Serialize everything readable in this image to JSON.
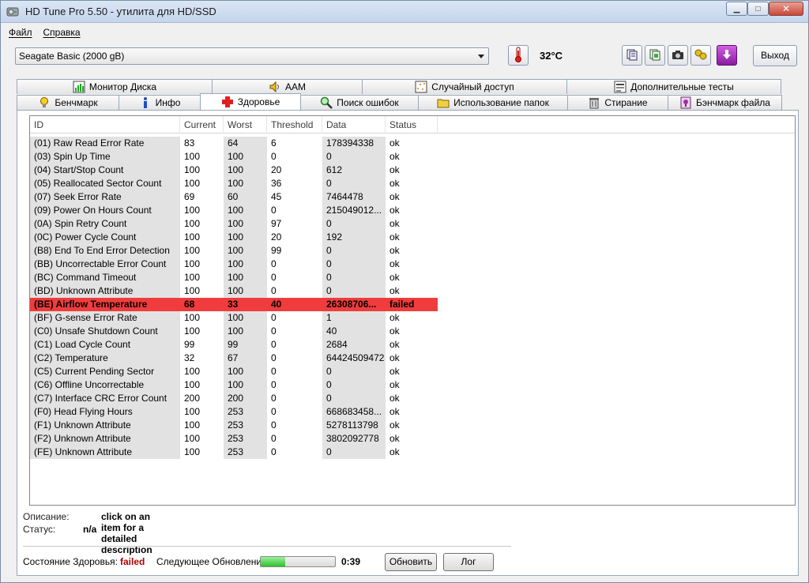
{
  "window": {
    "title": "HD Tune Pro 5.50 - утилита для HD/SSD"
  },
  "menu": {
    "file": "Файл",
    "help": "Справка"
  },
  "toolbar": {
    "drive": "Seagate Basic (2000 gB)",
    "temperature": "32°C",
    "exit_label": "Выход"
  },
  "tabs_top": [
    {
      "label": "Монитор Диска",
      "icon": "monitor-chart-icon"
    },
    {
      "label": "AAM",
      "icon": "speaker-icon"
    },
    {
      "label": "Случайный доступ",
      "icon": "random-access-icon"
    },
    {
      "label": "Дополнительные  тесты",
      "icon": "extra-tests-icon"
    }
  ],
  "tabs_bottom": [
    {
      "label": "Бенчмарк",
      "icon": "lightbulb-icon"
    },
    {
      "label": "Инфо",
      "icon": "info-icon"
    },
    {
      "label": "Здоровье",
      "icon": "health-cross-icon"
    },
    {
      "label": "Поиск ошибок",
      "icon": "magnifier-icon"
    },
    {
      "label": "Использование папок",
      "icon": "folder-icon"
    },
    {
      "label": "Стирание",
      "icon": "trash-icon"
    },
    {
      "label": "Бэнчмарк файла",
      "icon": "file-benchmark-icon"
    }
  ],
  "table": {
    "columns": [
      "ID",
      "Current",
      "Worst",
      "Threshold",
      "Data",
      "Status"
    ],
    "rows": [
      [
        "(01) Raw Read Error Rate",
        "83",
        "64",
        "6",
        "178394338",
        "ok"
      ],
      [
        "(03) Spin Up Time",
        "100",
        "100",
        "0",
        "0",
        "ok"
      ],
      [
        "(04) Start/Stop Count",
        "100",
        "100",
        "20",
        "612",
        "ok"
      ],
      [
        "(05) Reallocated Sector Count",
        "100",
        "100",
        "36",
        "0",
        "ok"
      ],
      [
        "(07) Seek Error Rate",
        "69",
        "60",
        "45",
        "7464478",
        "ok"
      ],
      [
        "(09) Power On Hours Count",
        "100",
        "100",
        "0",
        "215049012...",
        "ok"
      ],
      [
        "(0A) Spin Retry Count",
        "100",
        "100",
        "97",
        "0",
        "ok"
      ],
      [
        "(0C) Power Cycle Count",
        "100",
        "100",
        "20",
        "192",
        "ok"
      ],
      [
        "(B8) End To End Error Detection",
        "100",
        "100",
        "99",
        "0",
        "ok"
      ],
      [
        "(BB) Uncorrectable Error Count",
        "100",
        "100",
        "0",
        "0",
        "ok"
      ],
      [
        "(BC) Command Timeout",
        "100",
        "100",
        "0",
        "0",
        "ok"
      ],
      [
        "(BD) Unknown Attribute",
        "100",
        "100",
        "0",
        "0",
        "ok"
      ],
      [
        "(BE) Airflow Temperature",
        "68",
        "33",
        "40",
        "26308706...",
        "failed"
      ],
      [
        "(BF) G-sense Error Rate",
        "100",
        "100",
        "0",
        "1",
        "ok"
      ],
      [
        "(C0) Unsafe Shutdown Count",
        "100",
        "100",
        "0",
        "40",
        "ok"
      ],
      [
        "(C1) Load Cycle Count",
        "99",
        "99",
        "0",
        "2684",
        "ok"
      ],
      [
        "(C2) Temperature",
        "32",
        "67",
        "0",
        "64424509472",
        "ok"
      ],
      [
        "(C5) Current Pending Sector",
        "100",
        "100",
        "0",
        "0",
        "ok"
      ],
      [
        "(C6) Offline Uncorrectable",
        "100",
        "100",
        "0",
        "0",
        "ok"
      ],
      [
        "(C7) Interface CRC Error Count",
        "200",
        "200",
        "0",
        "0",
        "ok"
      ],
      [
        "(F0) Head Flying Hours",
        "100",
        "253",
        "0",
        "668683458...",
        "ok"
      ],
      [
        "(F1) Unknown Attribute",
        "100",
        "253",
        "0",
        "5278113798",
        "ok"
      ],
      [
        "(F2) Unknown Attribute",
        "100",
        "253",
        "0",
        "3802092778",
        "ok"
      ],
      [
        "(FE) Unknown Attribute",
        "100",
        "253",
        "0",
        "0",
        "ok"
      ]
    ]
  },
  "details": {
    "description_label": "Описание:",
    "description_value": "click on an item for a detailed description",
    "status_label": "Статус:",
    "status_value": "n/a"
  },
  "footer": {
    "health_label": "Состояние Здоровья:",
    "health_value": "failed",
    "next_update_label": "Следующее Обновление:",
    "progress_fraction": 0.33,
    "countdown": "0:39",
    "refresh_label": "Обновить",
    "log_label": "Лог"
  },
  "colors": {
    "failed_row": "#f03c3c",
    "failed_text": "#b00000",
    "progress": "#2ec02e"
  }
}
